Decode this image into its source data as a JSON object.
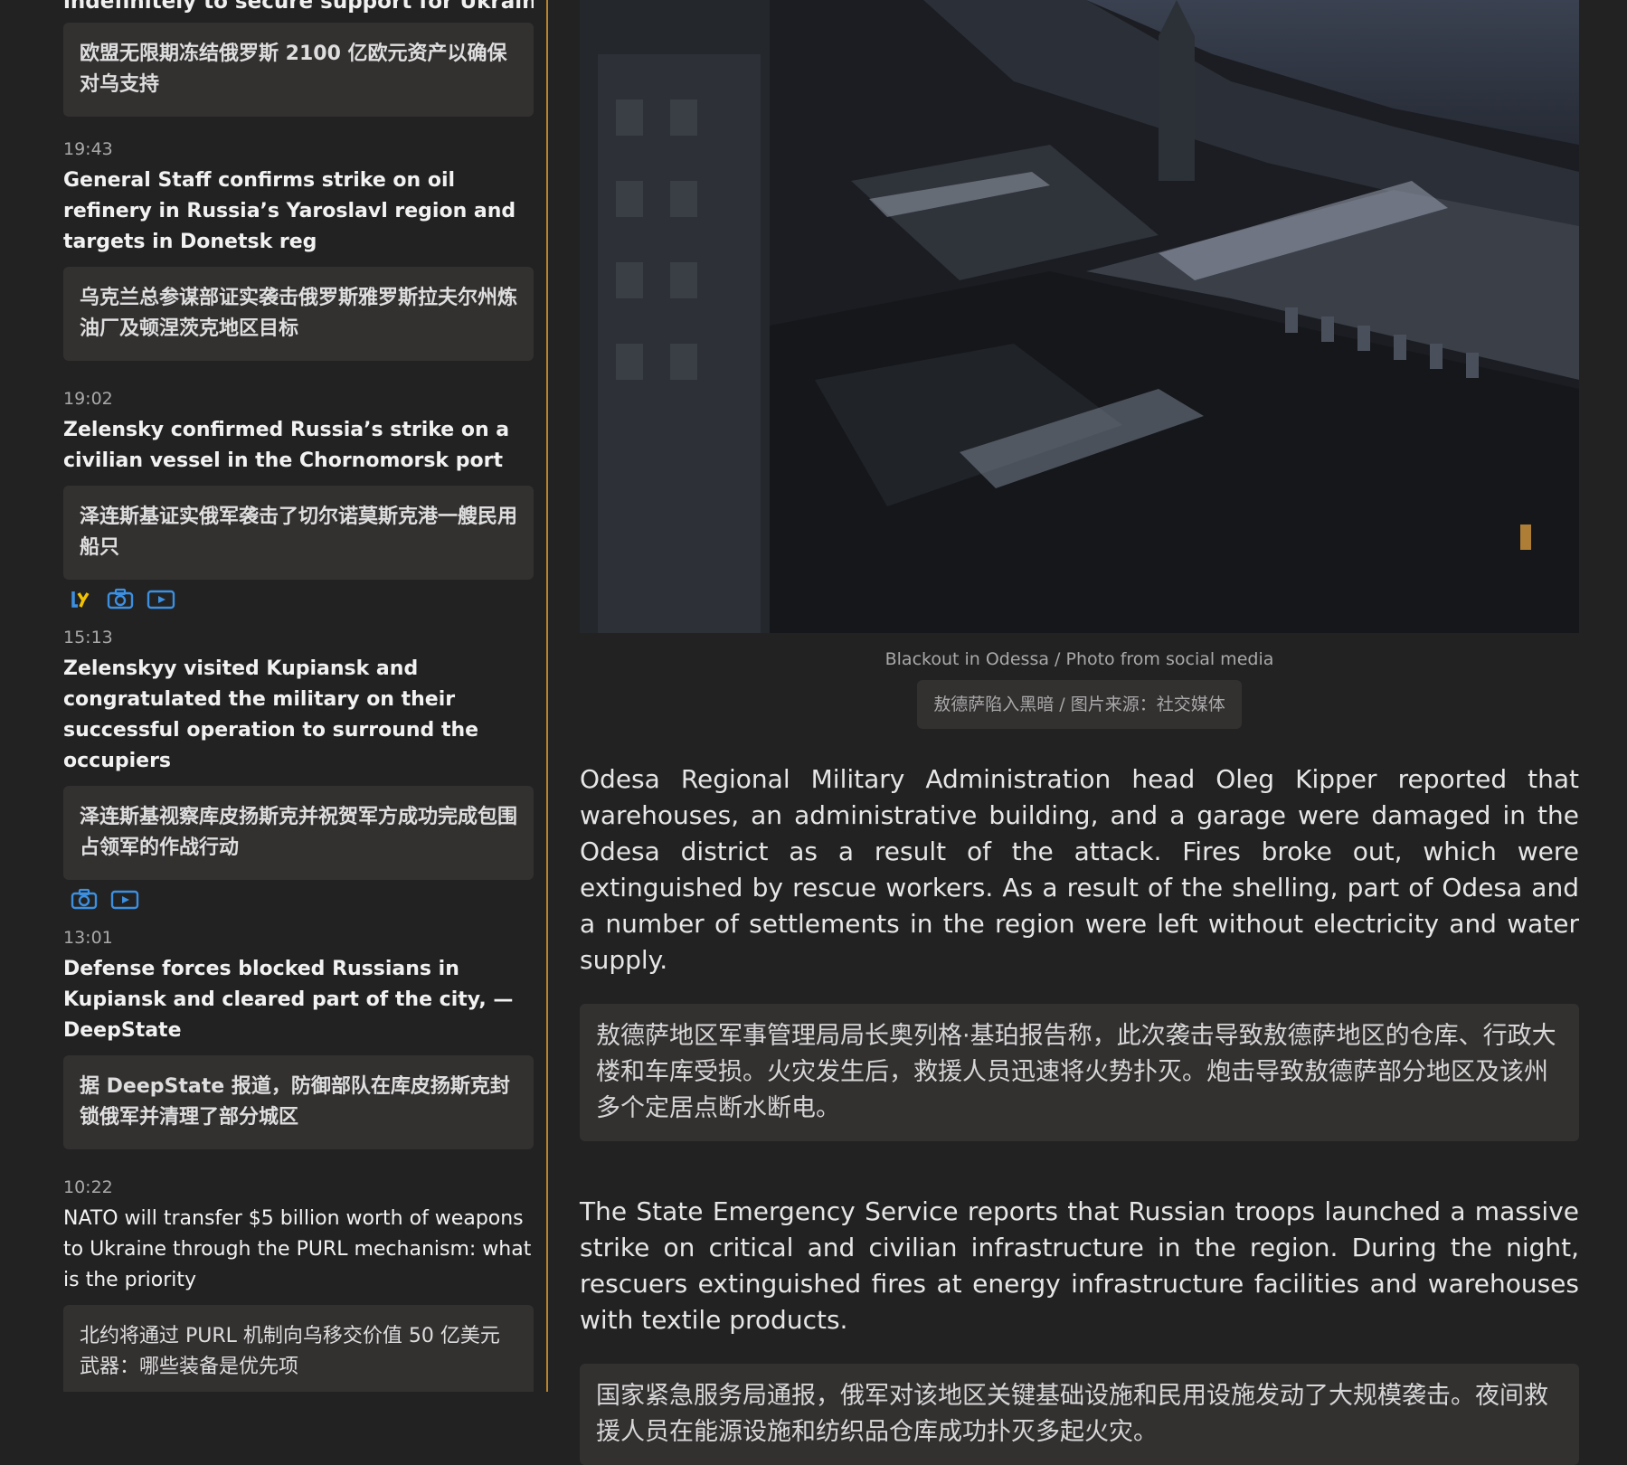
{
  "sidebar": {
    "partial_title": "indefinitely to secure support for Ukraine",
    "first_translation": "欧盟无限期冻结俄罗斯 2100 亿欧元资产以确保对乌支持",
    "items": [
      {
        "time": "19:43",
        "title": "General Staff confirms strike on oil refinery in Russia’s Yaroslavl region and targets in Donetsk reg",
        "translation": "乌克兰总参谋部证实袭击俄罗斯雅罗斯拉夫尔州炼油厂及顿涅茨克地区目标"
      },
      {
        "time": "19:02",
        "title": "Zelensky confirmed Russia’s strike on a civilian vessel in the Chornomorsk port",
        "translation": "泽连斯基证实俄军袭击了切尔诺莫斯克港一艘民用船只",
        "media": [
          "y-logo-icon",
          "camera-icon",
          "video-icon"
        ]
      },
      {
        "time": "15:13",
        "title": "Zelenskyy visited Kupiansk and congratulated the military on their successful operation to surround the occupiers",
        "translation": "泽连斯基视察库皮扬斯克并祝贺军方成功完成包围占领军的作战行动",
        "media": [
          "camera-icon",
          "video-icon"
        ]
      },
      {
        "time": "13:01",
        "title": "Defense forces blocked Russians in Kupiansk and cleared part of the city, — DeepState",
        "translation": "据 DeepState 报道，防御部队在库皮扬斯克封锁俄军并清理了部分城区"
      },
      {
        "time": "10:22",
        "title": "NATO will transfer $5 billion worth of weapons to Ukraine through the PURL mechanism: what is the priority",
        "translation": "北约将通过 PURL 机制向乌移交价值 50 亿美元武器：哪些装备是优先项"
      }
    ]
  },
  "article": {
    "caption": "Blackout in Odessa / Photo from social media",
    "caption_translation": "敖德萨陷入黑暗 / 图片来源：社交媒体",
    "paragraphs": [
      {
        "text": "Odesa Regional Military Administration head Oleg Kipper reported that warehouses, an administrative building, and a garage were damaged in the Odesa district as a result of the attack. Fires broke out, which were extinguished by rescue workers. As a result of the shelling, part of Odesa and a number of settlements in the region were left without electricity and water supply.",
        "translation": "敖德萨地区军事管理局局长奥列格·基珀报告称，此次袭击导致敖德萨地区的仓库、行政大楼和车库受损。火灾发生后，救援人员迅速将火势扑灭。炮击导致敖德萨部分地区及该州多个定居点断水断电。"
      },
      {
        "text": "The State Emergency Service reports that Russian troops launched a massive strike on critical and civilian infrastructure in the region. During the night, rescuers extinguished fires at energy infrastructure facilities and warehouses with textile products.",
        "translation": "国家紧急服务局通报，俄军对该地区关键基础设施和民用设施发动了大规模袭击。夜间救援人员在能源设施和纺织品仓库成功扑灭多起火灾。"
      }
    ]
  },
  "colors": {
    "background": "#222222",
    "translation_box": "#333030",
    "sidebar_divider": "#b8862e",
    "media_icon": "#3d8fe0",
    "y_logo_yellow": "#f2c200"
  }
}
